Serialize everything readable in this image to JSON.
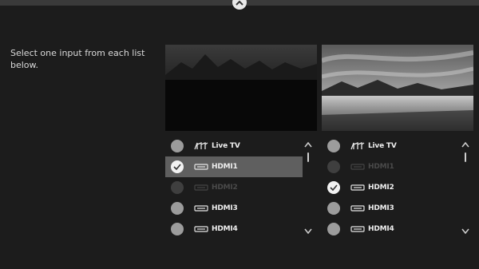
{
  "instructions": "Select one input from each list below.",
  "left_panel": {
    "items": [
      {
        "label": "Live TV",
        "icon": "antenna-icon",
        "state": "normal"
      },
      {
        "label": "HDMI1",
        "icon": "hdmi-icon",
        "state": "selected"
      },
      {
        "label": "HDMI2",
        "icon": "hdmi-icon",
        "state": "disabled"
      },
      {
        "label": "HDMI3",
        "icon": "hdmi-icon",
        "state": "normal"
      },
      {
        "label": "HDMI4",
        "icon": "hdmi-icon",
        "state": "normal"
      }
    ]
  },
  "right_panel": {
    "items": [
      {
        "label": "Live TV",
        "icon": "antenna-icon",
        "state": "normal"
      },
      {
        "label": "HDMI1",
        "icon": "hdmi-icon",
        "state": "disabled"
      },
      {
        "label": "HDMI2",
        "icon": "hdmi-icon",
        "state": "selected"
      },
      {
        "label": "HDMI3",
        "icon": "hdmi-icon",
        "state": "normal"
      },
      {
        "label": "HDMI4",
        "icon": "hdmi-icon",
        "state": "normal"
      }
    ]
  },
  "colors": {
    "background": "#1c1c1c",
    "selected_row": "#5f5f5f",
    "text": "#eeeeee"
  }
}
